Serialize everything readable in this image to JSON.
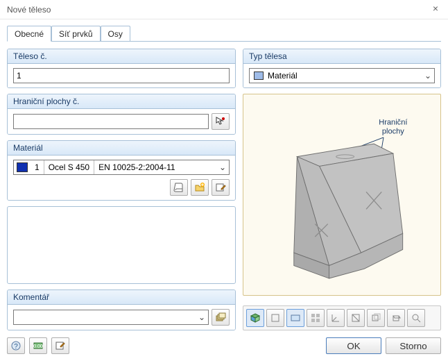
{
  "window": {
    "title": "Nové těleso"
  },
  "tabs": {
    "general": "Obecné",
    "mesh": "Síť prvků",
    "axes": "Osy"
  },
  "left": {
    "body_no": {
      "header": "Těleso č.",
      "value": "1"
    },
    "boundary": {
      "header": "Hraniční plochy č.",
      "value": ""
    },
    "material": {
      "header": "Materiál",
      "number": "1",
      "name": "Ocel S 450",
      "standard": "EN 10025-2:2004-11"
    },
    "comment": {
      "header": "Komentář",
      "value": ""
    }
  },
  "right": {
    "type": {
      "header": "Typ tělesa",
      "value": "Materiál"
    },
    "preview_label": "Hraniční\nplochy"
  },
  "footer": {
    "ok": "OK",
    "cancel": "Storno"
  }
}
